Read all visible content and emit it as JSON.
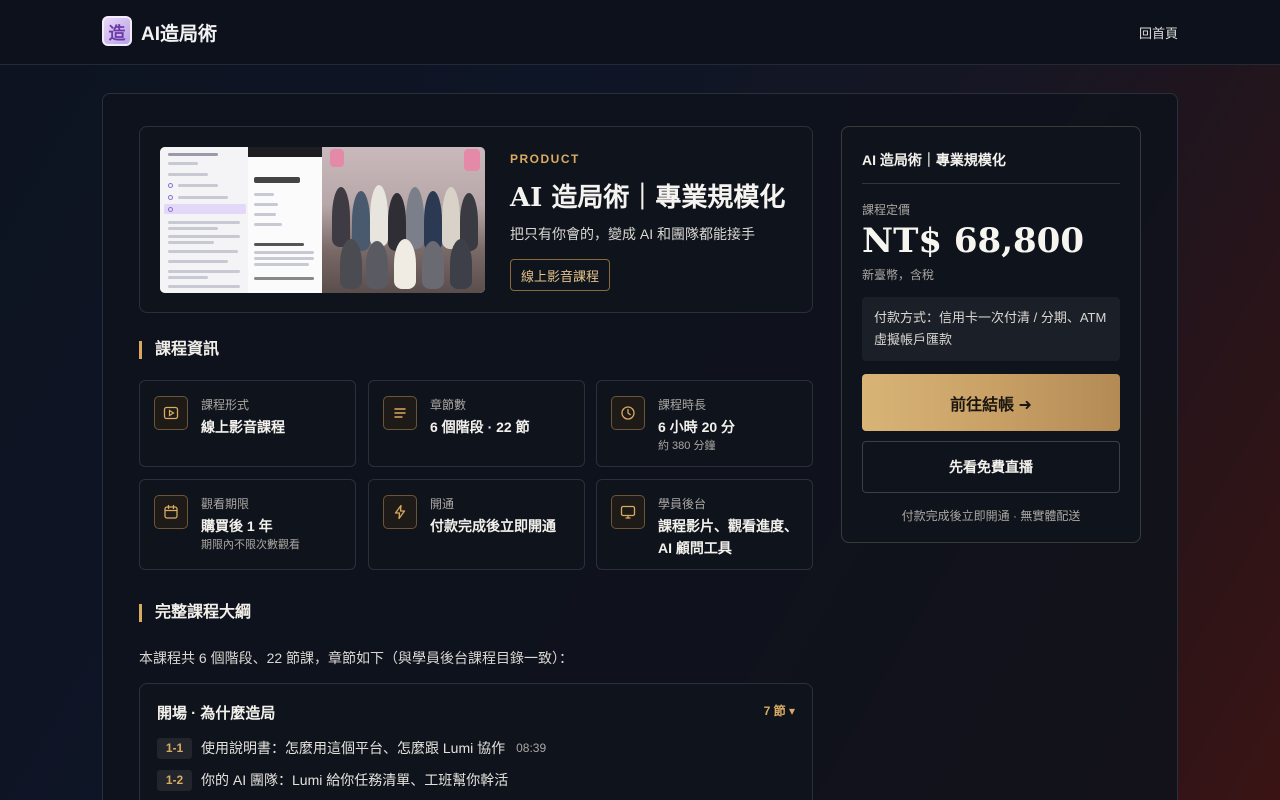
{
  "nav": {
    "brand": "AI造局術",
    "logo_glyph": "造",
    "home_link": "回首頁"
  },
  "hero": {
    "eyebrow": "PRODUCT",
    "title": "AI 造局術｜專業規模化",
    "subtitle": "把只有你會的，變成 AI 和團隊都能接手",
    "badge": "線上影音課程"
  },
  "course_info": {
    "heading": "課程資訊",
    "cards": [
      {
        "icon": "play-icon",
        "label": "課程形式",
        "value": "線上影音課程",
        "note": ""
      },
      {
        "icon": "list-icon",
        "label": "章節數",
        "value": "6 個階段 · 22 節",
        "note": ""
      },
      {
        "icon": "clock-icon",
        "label": "課程時長",
        "value": "6 小時 20 分",
        "note": "約 380 分鐘"
      },
      {
        "icon": "calendar-icon",
        "label": "觀看期限",
        "value": "購買後 1 年",
        "note": "期限內不限次數觀看"
      },
      {
        "icon": "lightning-icon",
        "label": "開通",
        "value": "付款完成後立即開通",
        "note": ""
      },
      {
        "icon": "monitor-icon",
        "label": "學員後台",
        "value": "課程影片、觀看進度、AI 顧問工具",
        "note": ""
      }
    ]
  },
  "outline": {
    "heading": "完整課程大綱",
    "intro": "本課程共 6 個階段、22 節課，章節如下（與學員後台課程目錄一致）：",
    "chapters": [
      {
        "title": "開場 · 為什麼造局",
        "count": "7 節 ▾",
        "lessons": [
          {
            "no": "1-1",
            "title": "使用說明書：怎麼用這個平台、怎麼跟 Lumi 協作",
            "time": "08:39"
          },
          {
            "no": "1-2",
            "title": "你的 AI 團隊：Lumi 給你任務清單、工班幫你幹活",
            "time": ""
          }
        ]
      }
    ]
  },
  "pricing": {
    "course_name": "AI 造局術｜專業規模化",
    "price_label": "課程定價",
    "price": "NT$ 68,800",
    "price_note": "新臺幣，含稅",
    "payment_methods": "付款方式：信用卡一次付清 / 分期、ATM 虛擬帳戶匯款",
    "checkout_label": "前往結帳 ➜",
    "free_live_label": "先看免費直播",
    "footnote": "付款完成後立即開通 · 無實體配送"
  },
  "colors": {
    "accent_gold": "#d8aa62",
    "card_bg": "#0f131c",
    "border": "#2a303b"
  }
}
